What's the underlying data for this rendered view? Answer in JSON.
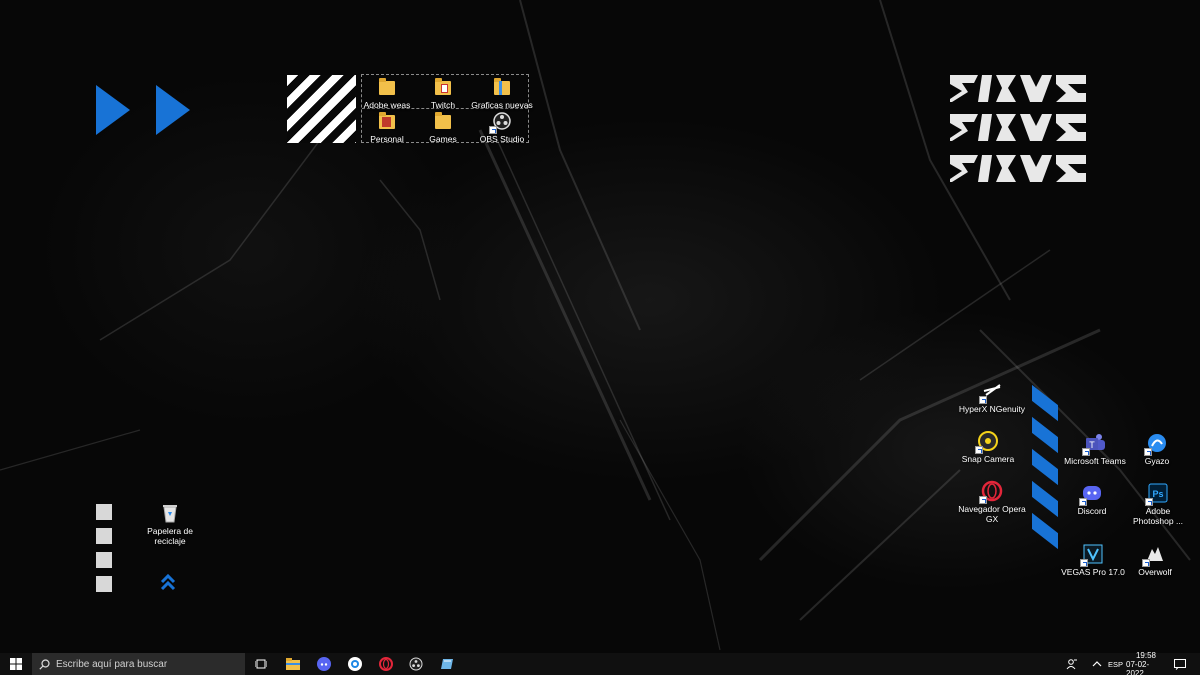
{
  "desktop": {
    "group_icons": [
      {
        "label": "Adobe weas",
        "icon": "folder-icon"
      },
      {
        "label": "Twitch",
        "icon": "folder-doc-icon"
      },
      {
        "label": "Graficas nuevas",
        "icon": "folder-icon"
      },
      {
        "label": "Personal",
        "icon": "folder-doc-icon"
      },
      {
        "label": "Games",
        "icon": "folder-icon"
      },
      {
        "label": "OBS Studio",
        "icon": "obs-icon"
      }
    ],
    "right_icons": [
      {
        "label": "HyperX NGenuity",
        "icon": "hyperx-icon"
      },
      {
        "label": "Snap Camera",
        "icon": "snap-camera-icon"
      },
      {
        "label": "Navegador Opera GX",
        "icon": "opera-gx-icon"
      },
      {
        "label": "Microsoft Teams",
        "icon": "teams-icon"
      },
      {
        "label": "Gyazo",
        "icon": "gyazo-icon"
      },
      {
        "label": "Discord",
        "icon": "discord-icon"
      },
      {
        "label": "Adobe Photoshop ...",
        "icon": "photoshop-icon"
      },
      {
        "label": "VEGAS Pro 17.0",
        "icon": "vegas-icon"
      },
      {
        "label": "Overwolf",
        "icon": "overwolf-icon"
      }
    ],
    "recycle_bin": {
      "label": "Papelera de reciclaje",
      "icon": "recycle-bin-icon"
    },
    "accent_color": "#1873d6"
  },
  "taskbar": {
    "search_placeholder": "Escribe aquí para buscar",
    "pinned": [
      "task-view-icon",
      "file-explorer-icon",
      "discord-icon",
      "chrome-canary-icon",
      "opera-gx-icon",
      "obs-icon",
      "app-icon"
    ],
    "language": "ESP",
    "time": "19:58",
    "date": "07-02-2022"
  }
}
